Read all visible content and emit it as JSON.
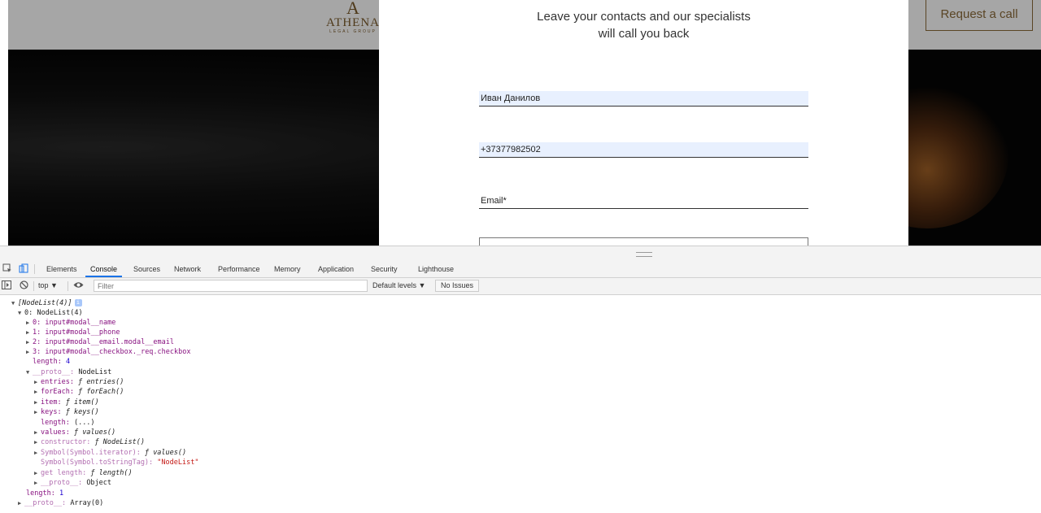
{
  "site": {
    "logo_mark": "A",
    "logo_name": "ATHENA",
    "logo_sub": "LEGAL GROUP",
    "request_button": "Request a call"
  },
  "modal": {
    "title_line1": "Leave your contacts and our specialists",
    "title_line2": "will call you back",
    "name_value": "Иван Данилов",
    "phone_value": "+37377982502",
    "email_placeholder": "Email*"
  },
  "devtools": {
    "tabs": [
      "Elements",
      "Console",
      "Sources",
      "Network",
      "Performance",
      "Memory",
      "Application",
      "Security",
      "Lighthouse"
    ],
    "active_tab": "Console",
    "context": "top ▼",
    "filter_placeholder": "Filter",
    "levels": "Default levels ▼",
    "issues": "No Issues",
    "icons": {
      "inspect": "inspect-icon",
      "device": "device-toolbar-icon",
      "sidebar": "sidebar-toggle-icon",
      "clear": "clear-console-icon",
      "eye": "live-expression-icon"
    }
  },
  "console": {
    "root": "[NodeList(4)]",
    "item0": "0: NodeList(4)",
    "nodes": [
      {
        "key": "0:",
        "value": "input#modal__name"
      },
      {
        "key": "1:",
        "value": "input#modal__phone"
      },
      {
        "key": "2:",
        "value": "input#modal__email.modal__email"
      },
      {
        "key": "3:",
        "value": "input#modal__checkbox._req.checkbox"
      }
    ],
    "length_key": "length:",
    "length_value": "4",
    "proto_key": "__proto__:",
    "proto_value": "NodeList",
    "proto_members": [
      {
        "key": "entries:",
        "value": "ƒ entries()"
      },
      {
        "key": "forEach:",
        "value": "ƒ forEach()"
      },
      {
        "key": "item:",
        "value": "ƒ item()"
      },
      {
        "key": "keys:",
        "value": "ƒ keys()"
      },
      {
        "key": "length:",
        "value": "(...)"
      },
      {
        "key": "values:",
        "value": "ƒ values()"
      },
      {
        "key": "constructor:",
        "value": "ƒ NodeList()"
      },
      {
        "key": "Symbol(Symbol.iterator):",
        "value": "ƒ values()"
      },
      {
        "key": "Symbol(Symbol.toStringTag):",
        "value": "\"NodeList\""
      },
      {
        "key": "get length:",
        "value": "ƒ length()"
      },
      {
        "key": "__proto__:",
        "value": "Object"
      }
    ],
    "outer_length_key": "length:",
    "outer_length_value": "1",
    "outer_proto_key": "__proto__:",
    "outer_proto_value": "Array(0)"
  }
}
